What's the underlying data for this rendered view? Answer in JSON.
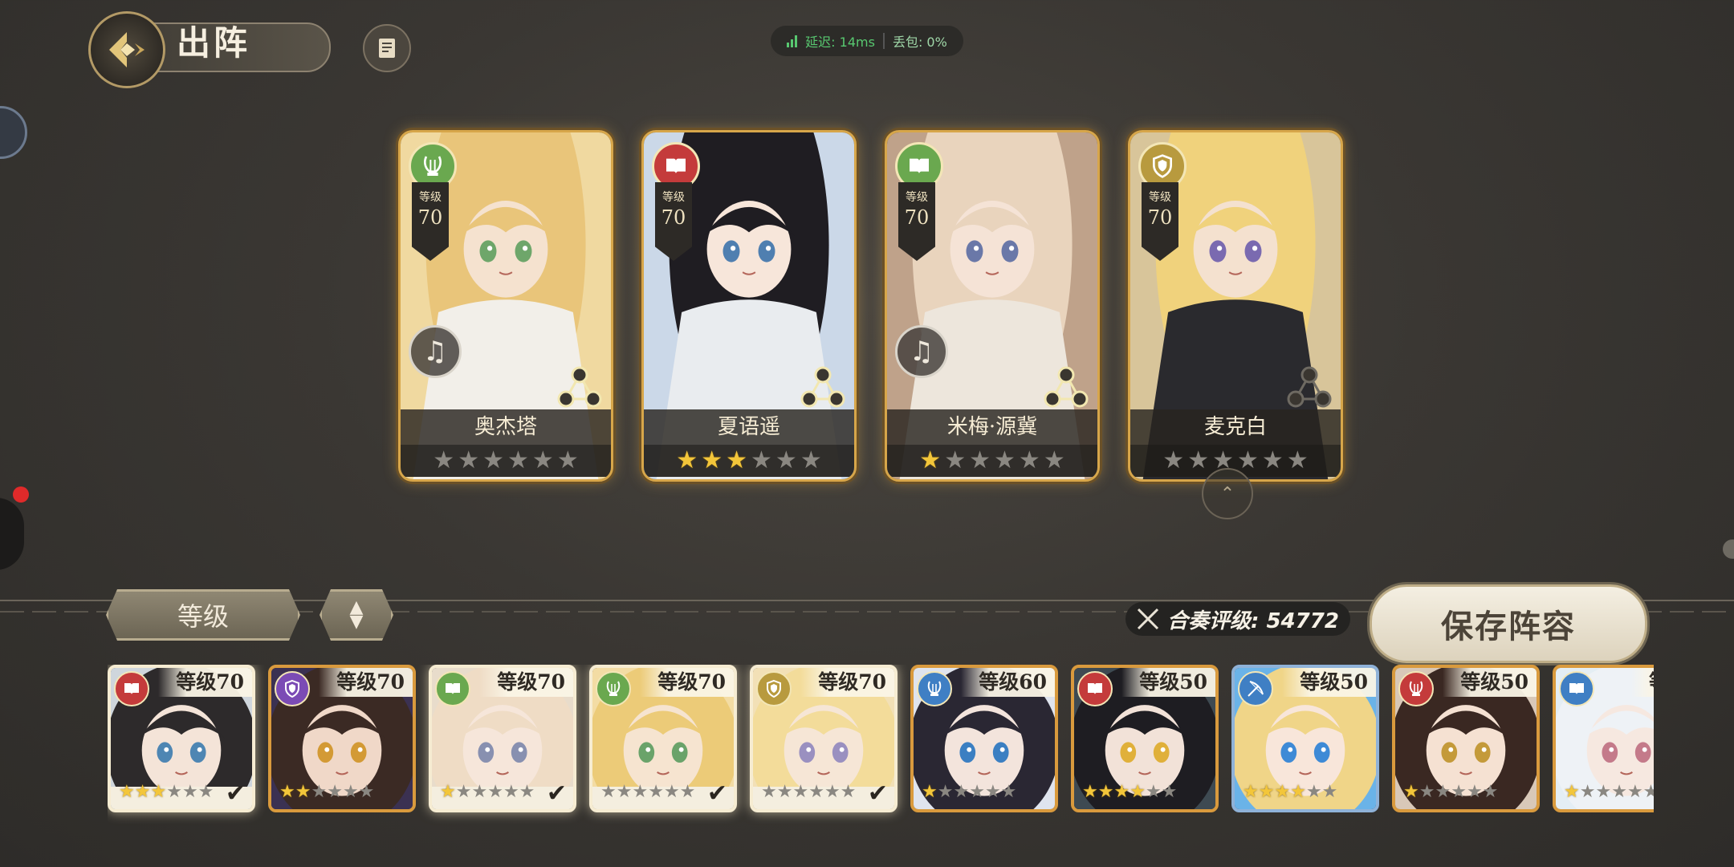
{
  "header": {
    "title": "出阵"
  },
  "network": {
    "latency": "延迟: 14ms",
    "loss": "丢包: 0%"
  },
  "team": [
    {
      "name": "奥杰塔",
      "level_label": "等级",
      "level": "70",
      "type_icon": "lyre-icon",
      "type_color": "#6aa84f",
      "role_icon": "music-note-icon",
      "stars_on": 0,
      "stars_total": 6,
      "art": {
        "bg": "#f0d9a0",
        "hair": "#e9c57a",
        "skin": "#f5e2cf",
        "eye": "#6ea66a",
        "cloth": "#f2efe9"
      }
    },
    {
      "name": "夏语遥",
      "level_label": "等级",
      "level": "70",
      "type_icon": "book-icon",
      "type_color": "#c43b3b",
      "role_icon": "",
      "stars_on": 3,
      "stars_total": 6,
      "art": {
        "bg": "#cbd8e8",
        "hair": "#1f1d22",
        "skin": "#f7e6da",
        "eye": "#4f7fb0",
        "cloth": "#e9ecef"
      }
    },
    {
      "name": "米梅·源冀",
      "level_label": "等级",
      "level": "70",
      "type_icon": "book-icon",
      "type_color": "#6aa84f",
      "role_icon": "music-note-icon",
      "stars_on": 1,
      "stars_total": 6,
      "art": {
        "bg": "#bfa28a",
        "hair": "#e9d4bd",
        "skin": "#f5e3d6",
        "eye": "#6a78a8",
        "cloth": "#ede6dc"
      }
    },
    {
      "name": "麦克白",
      "level_label": "等级",
      "level": "70",
      "type_icon": "shield-icon",
      "type_color": "#b89a3e",
      "role_icon": "",
      "stars_on": 0,
      "stars_total": 6,
      "art": {
        "bg": "#d8c59a",
        "hair": "#f0d27c",
        "skin": "#f4e1cf",
        "eye": "#7a6ab0",
        "cloth": "#2a2a2e"
      }
    }
  ],
  "controls": {
    "sort_label": "等级",
    "order_icon": "sort-up-down-icon"
  },
  "power": {
    "text": "合奏评级: 54772",
    "icon": "crossed-swords-icon"
  },
  "save_label": "保存阵容",
  "roster": [
    {
      "level_text": "等级70",
      "type_icon": "book-icon",
      "type_color": "#c43b3b",
      "stars_on": 3,
      "selected": true,
      "frame": "gold",
      "art": {
        "bg": "#cfd6dc",
        "hair": "#2d2a2b",
        "skin": "#f4e4d8",
        "eye": "#4e86b3"
      }
    },
    {
      "level_text": "等级70",
      "type_icon": "shield-icon",
      "type_color": "#7b4bb5",
      "stars_on": 2,
      "selected": false,
      "frame": "gold",
      "art": {
        "bg": "#3b3152",
        "hair": "#3b2a24",
        "skin": "#f0d8c8",
        "eye": "#d39a35"
      }
    },
    {
      "level_text": "等级70",
      "type_icon": "book-icon",
      "type_color": "#6aa84f",
      "stars_on": 1,
      "selected": true,
      "frame": "gold",
      "art": {
        "bg": "#e8dccb",
        "hair": "#efdcc5",
        "skin": "#f6e6da",
        "eye": "#8890b0"
      }
    },
    {
      "level_text": "等级70",
      "type_icon": "lyre-icon",
      "type_color": "#6aa84f",
      "stars_on": 0,
      "selected": true,
      "frame": "gold",
      "art": {
        "bg": "#f3dca4",
        "hair": "#eccb78",
        "skin": "#f6e4d0",
        "eye": "#6aa36a"
      }
    },
    {
      "level_text": "等级70",
      "type_icon": "shield-icon",
      "type_color": "#b89a3e",
      "stars_on": 0,
      "selected": true,
      "frame": "gold",
      "art": {
        "bg": "#f2e0b6",
        "hair": "#f3dc9a",
        "skin": "#f6e6d6",
        "eye": "#9a90c0"
      }
    },
    {
      "level_text": "等级60",
      "type_icon": "lyre-icon",
      "type_color": "#3f7fc4",
      "stars_on": 1,
      "selected": false,
      "frame": "gold",
      "art": {
        "bg": "#dfe4ee",
        "hair": "#2a2733",
        "skin": "#f3e4dc",
        "eye": "#3b7fc2"
      }
    },
    {
      "level_text": "等级50",
      "type_icon": "book-icon",
      "type_color": "#c43b3b",
      "stars_on": 4,
      "selected": false,
      "frame": "gold",
      "art": {
        "bg": "#3e4a52",
        "hair": "#1e1d22",
        "skin": "#f2e2d8",
        "eye": "#e0b03a"
      }
    },
    {
      "level_text": "等级50",
      "type_icon": "bow-icon",
      "type_color": "#3f7fc4",
      "stars_on": 4,
      "selected": false,
      "frame": "blue",
      "art": {
        "bg": "#6ab3e8",
        "hair": "#f0d588",
        "skin": "#f8e6da",
        "eye": "#3e8ad6"
      }
    },
    {
      "level_text": "等级50",
      "type_icon": "lyre-icon",
      "type_color": "#c43b3b",
      "stars_on": 1,
      "selected": false,
      "frame": "gold",
      "art": {
        "bg": "#d8c8b8",
        "hair": "#3a2822",
        "skin": "#f5e1d2",
        "eye": "#c49a3a"
      }
    },
    {
      "level_text": "等级",
      "type_icon": "book-icon",
      "type_color": "#3f7fc4",
      "stars_on": 1,
      "selected": false,
      "frame": "gold",
      "art": {
        "bg": "#e4eef4",
        "hair": "#eef2f6",
        "skin": "#f6e8e0",
        "eye": "#c47a8a"
      }
    }
  ]
}
